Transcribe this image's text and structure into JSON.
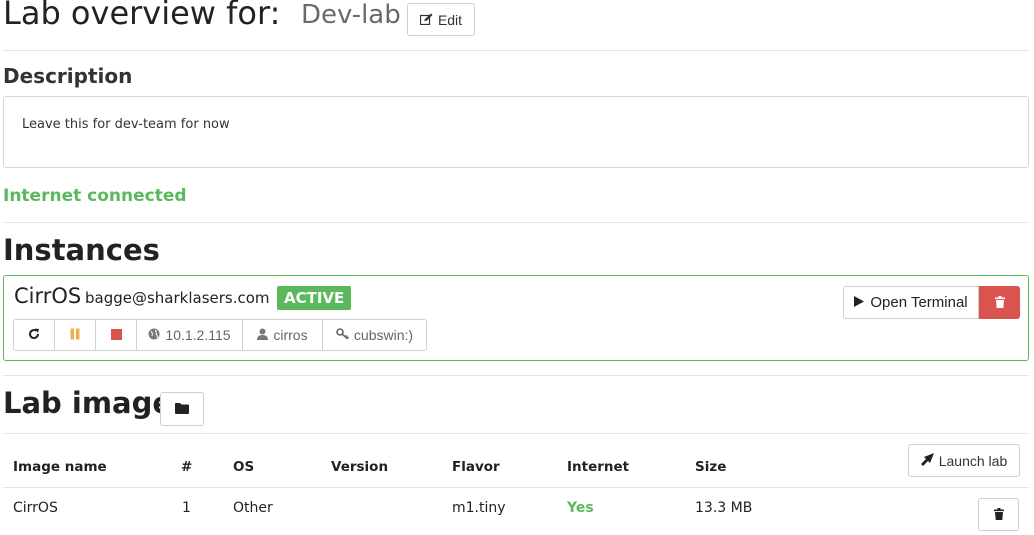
{
  "header": {
    "title_prefix": "Lab overview for:",
    "lab_name": "Dev-lab",
    "edit_label": "Edit"
  },
  "description": {
    "heading": "Description",
    "text": "Leave this for dev-team for now"
  },
  "internet_status": "Internet connected",
  "instances": {
    "heading": "Instances",
    "items": [
      {
        "name": "CirrOS",
        "owner": "bagge@sharklasers.com",
        "status": "ACTIVE",
        "ip": "10.1.2.115",
        "user": "cirros",
        "password": "cubswin:)",
        "open_terminal_label": "Open Terminal"
      }
    ]
  },
  "lab_images": {
    "heading": "Lab images",
    "launch_label": "Launch lab",
    "columns": [
      "Image name",
      "#",
      "OS",
      "Version",
      "Flavor",
      "Internet",
      "Size"
    ],
    "rows": [
      {
        "image_name": "CirrOS",
        "count": "1",
        "os": "Other",
        "version": "",
        "flavor": "m1.tiny",
        "internet": "Yes",
        "size": "13.3 MB"
      }
    ]
  },
  "colors": {
    "success": "#5cb85c",
    "danger": "#d9534f",
    "pause": "#f0ad4e"
  }
}
